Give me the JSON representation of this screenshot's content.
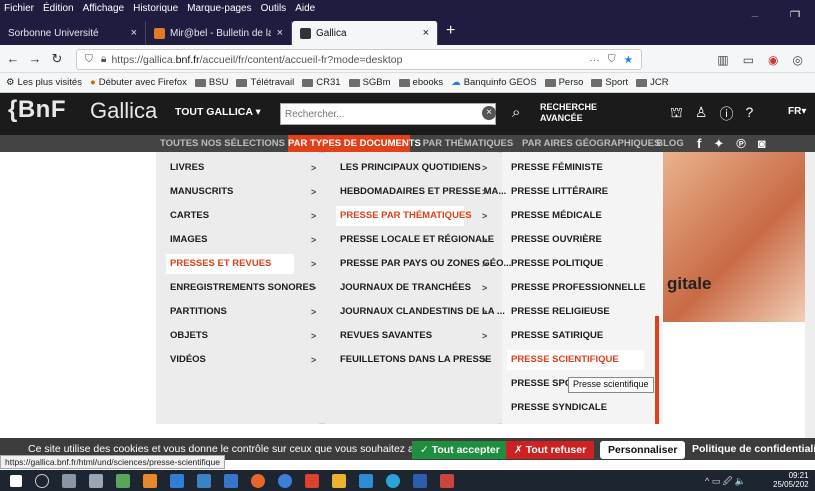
{
  "menubar": {
    "items": [
      "Fichier",
      "Édition",
      "Affichage",
      "Historique",
      "Marque-pages",
      "Outils",
      "Aide"
    ]
  },
  "window_controls": {
    "minimize": "–",
    "restore": "❐"
  },
  "tabs": [
    {
      "title": "Sorbonne Université",
      "close": "×"
    },
    {
      "title": "Mir@bel - Bulletin de la Sociét",
      "close": "×"
    },
    {
      "title": "Gallica",
      "close": "×"
    }
  ],
  "newtab_label": "+",
  "url": {
    "prefix": "https://gallica.",
    "domain": "bnf.fr",
    "rest": "/accueil/fr/content/accueil-fr?mode=desktop",
    "dots": "···"
  },
  "bookmarks": [
    "Les plus visités",
    "Débuter avec Firefox",
    "BSU",
    "Télétravail",
    "CR31",
    "SGBm",
    "ebooks",
    "Banquinfo GEOS",
    "Perso",
    "Sport",
    "JCR"
  ],
  "site": {
    "logo": "{BnF",
    "name": "Gallica",
    "tout": "TOUT GALLICA ▾",
    "search_placeholder": "Rechercher...",
    "adv_search_1": "RECHERCHE",
    "adv_search_2": "AVANCÉE",
    "lang": "FR▾"
  },
  "sitenav": {
    "items": [
      "TOUTES NOS SÉLECTIONS",
      "PAR TYPES DE DOCUMENTS",
      "PAR THÉMATIQUES",
      "PAR AIRES GÉOGRAPHIQUES",
      "BLOG"
    ]
  },
  "menu": {
    "col1": [
      "LIVRES",
      "MANUSCRITS",
      "CARTES",
      "IMAGES",
      "PRESSES ET REVUES",
      "ENREGISTREMENTS SONORES",
      "PARTITIONS",
      "OBJETS",
      "VIDÉOS"
    ],
    "col1_selected": 4,
    "col2": [
      "LES PRINCIPAUX QUOTIDIENS",
      "HEBDOMADAIRES ET PRESSE MA...",
      "PRESSE PAR THÉMATIQUES",
      "PRESSE LOCALE ET RÉGIONALE",
      "PRESSE PAR PAYS OU ZONES GÉO...",
      "JOURNAUX DE TRANCHÉES",
      "JOURNAUX CLANDESTINS DE LA ...",
      "REVUES SAVANTES",
      "FEUILLETONS DANS LA PRESSE"
    ],
    "col2_selected": 2,
    "col3": [
      "PRESSE FÉMINISTE",
      "PRESSE LITTÉRAIRE",
      "PRESSE MÉDICALE",
      "PRESSE OUVRIÈRE",
      "PRESSE POLITIQUE",
      "PRESSE PROFESSIONNELLE",
      "PRESSE RELIGIEUSE",
      "PRESSE SATIRIQUE",
      "PRESSE SCIENTIFIQUE",
      "PRESSE SPORTI",
      "PRESSE SYNDICALE"
    ],
    "col3_selected": 8,
    "tooltip": "Presse scientifique",
    "chevron": ">"
  },
  "background": {
    "partial_title": "gitale"
  },
  "cookie": {
    "text": "Ce site utilise des cookies et vous donne le contrôle sur ceux que vous souhaitez activer",
    "accept": "✓ Tout accepter",
    "refuse": "✗ Tout refuser",
    "customize": "Personnaliser",
    "policy": "Politique de confidentialité"
  },
  "status_url": "https://gallica.bnf.fr/html/und/sciences/presse-scientifique",
  "clock": {
    "time": "09:21",
    "date": "25/05/202"
  },
  "tray": "^ ▭ 🖉 🔈",
  "colors": {
    "accent": "#e0401a",
    "header": "#1b1b1b",
    "nav": "#444444",
    "accept": "#1e8f3e",
    "refuse": "#cc2222"
  }
}
